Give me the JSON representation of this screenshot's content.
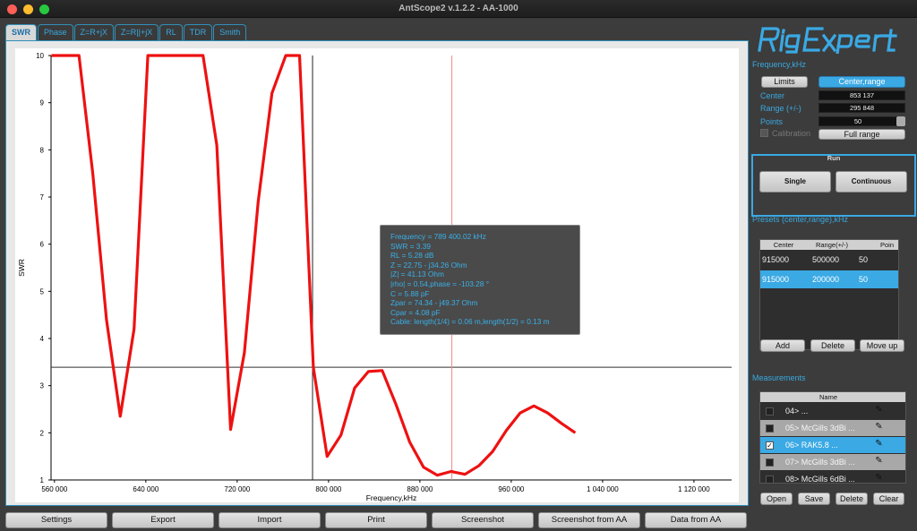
{
  "window": {
    "title": "AntScope2 v.1.2.2 - AA-1000"
  },
  "tabs": [
    "SWR",
    "Phase",
    "Z=R+jX",
    "Z=R||+jX",
    "RL",
    "TDR",
    "Smith"
  ],
  "active_tab": "SWR",
  "tooltip": {
    "lines": [
      "Frequency = 789 400.02 kHz",
      "SWR = 3.39",
      "RL = 5.28 dB",
      "Z = 22.75 - j34.26 Ohm",
      "|Z| = 41.13 Ohm",
      "|rho| = 0.54,phase = -103.28 °",
      "C = 5.88 pF",
      "Zpar = 74.34 - j49.37 Ohm",
      "Cpar = 4.08 pF",
      "Cable: length(1/4) = 0.06 m,length(1/2) = 0.13 m"
    ]
  },
  "chart_data": {
    "type": "line",
    "xlabel": "Frequency,kHz",
    "ylabel": "SWR",
    "xlim": [
      557000,
      1153000
    ],
    "ylim": [
      1,
      10
    ],
    "x_ticks": [
      560000,
      640000,
      720000,
      800000,
      880000,
      960000,
      1040000,
      1120000
    ],
    "x_tick_labels": [
      "560 000",
      "640 000",
      "720 000",
      "800 000",
      "880 000",
      "960 000",
      "1 040 000",
      "1 120 000"
    ],
    "y_ticks": [
      1,
      2,
      3,
      4,
      5,
      6,
      7,
      8,
      9,
      10
    ],
    "y_tick_labels": [
      "1",
      "2",
      "3",
      "4",
      "5",
      "6",
      "7",
      "8",
      "9",
      "10"
    ],
    "series": [
      {
        "color": "#ee1111",
        "x": [
          557289,
          569362,
          581434,
          593507,
          605579,
          617652,
          629724,
          641797,
          653869,
          665941,
          678014,
          690086,
          702159,
          714231,
          726304,
          738376,
          750449,
          762521,
          774593,
          786666,
          798738,
          810811,
          822883,
          834956,
          847028,
          859100,
          871173,
          883245,
          895318,
          907390,
          919463,
          931535,
          943608,
          955680,
          967752,
          979825,
          991897,
          1003970,
          1016042
        ],
        "y": [
          10,
          10,
          10,
          7.5,
          4.4,
          2.35,
          4.2,
          10,
          10,
          10,
          10,
          10,
          8.1,
          2.07,
          3.7,
          6.9,
          9.2,
          10,
          10,
          3.39,
          1.5,
          1.95,
          2.95,
          3.3,
          3.32,
          2.6,
          1.8,
          1.27,
          1.1,
          1.18,
          1.12,
          1.3,
          1.6,
          2.05,
          2.42,
          2.57,
          2.42,
          2.2,
          2.0
        ]
      }
    ],
    "marker_vertical_x": 786000,
    "cursor_vertical_x": 908000,
    "horizontal_line_y": 3.39
  },
  "frequency": {
    "title": "Frequency,kHz",
    "limits_label": "Limits",
    "center_range_label": "Center,range",
    "center_label": "Center",
    "center_value": "853 137",
    "range_label": "Range (+/-)",
    "range_value": "295 848",
    "points_label": "Points",
    "points_value": "50",
    "calibration_label": "Calibration",
    "full_range_label": "Full range"
  },
  "run": {
    "title": "Run",
    "single_label": "Single",
    "continuous_label": "Continuous"
  },
  "presets": {
    "title": "Presets (center,range),kHz",
    "headers": [
      "Center",
      "Range(+/-)",
      "Poin"
    ],
    "rows": [
      [
        "915000",
        "500000",
        "50"
      ],
      [
        "915000",
        "200000",
        "50"
      ]
    ],
    "selected_row": 1,
    "add_label": "Add",
    "delete_label": "Delete",
    "move_up_label": "Move up"
  },
  "measurements": {
    "title": "Measurements",
    "header_name": "Name",
    "rows": [
      {
        "name": "04> ...",
        "checked": false
      },
      {
        "name": "05> McGills 3dBi ...",
        "checked": false
      },
      {
        "name": "06> RAK5.8 ...",
        "checked": true
      },
      {
        "name": "07> McGills 3dBi ...",
        "checked": false
      },
      {
        "name": "08> McGills 6dBi ...",
        "checked": false
      }
    ],
    "selected_row": 2,
    "open_label": "Open",
    "save_label": "Save",
    "delete_label": "Delete",
    "clear_label": "Clear"
  },
  "bottom_bar": [
    "Settings",
    "Export",
    "Import",
    "Print",
    "Screenshot",
    "Screenshot from AA",
    "Data from AA"
  ],
  "colors": {
    "accent": "#3aa9e4",
    "trace": "#ee1111",
    "background": "#3c3c3c"
  }
}
